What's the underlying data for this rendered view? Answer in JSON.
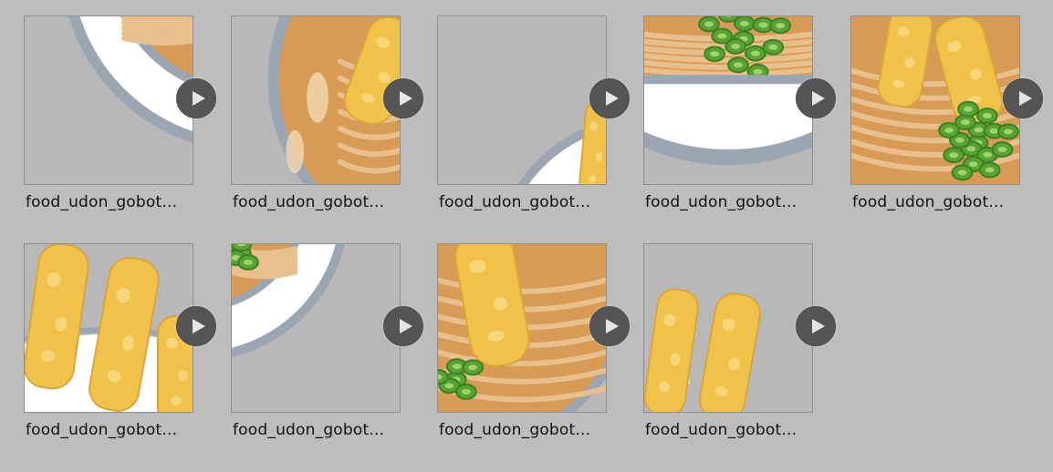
{
  "assets": [
    {
      "label": "food_udon_gobot...",
      "variant": "bowl-rim-left"
    },
    {
      "label": "food_udon_gobot...",
      "variant": "bowl-edge-tempura"
    },
    {
      "label": "food_udon_gobot...",
      "variant": "bowl-corner"
    },
    {
      "label": "food_udon_gobot...",
      "variant": "bowl-front-onions"
    },
    {
      "label": "food_udon_gobot...",
      "variant": "tempura-onions"
    },
    {
      "label": "food_udon_gobot...",
      "variant": "tempura-sticks"
    },
    {
      "label": "food_udon_gobot...",
      "variant": "bowl-rim-onion"
    },
    {
      "label": "food_udon_gobot...",
      "variant": "noodles-tempura"
    },
    {
      "label": "food_udon_gobot...",
      "variant": "tempura-sticks-small"
    }
  ],
  "icons": {
    "play": "play-icon"
  },
  "colors": {
    "background": "#bdbdbd",
    "tile_background": "#b8b8b8",
    "bowl_rim": "#9aa7b3",
    "bowl_white": "#ffffff",
    "broth": "#d89b55",
    "noodle": "#e7c08d",
    "tempura": "#f0c24a",
    "onion": "#58a432",
    "play_button": "#555555"
  }
}
